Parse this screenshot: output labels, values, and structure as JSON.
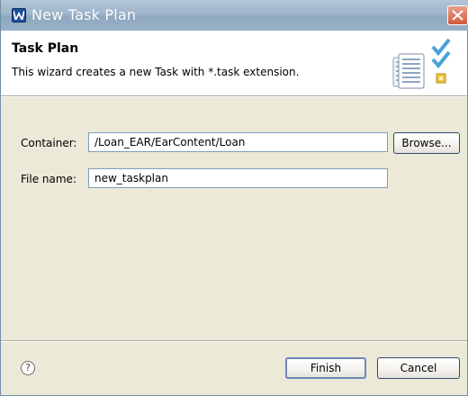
{
  "window": {
    "title": "New Task Plan",
    "app_icon": "websphere-icon",
    "close_icon": "close-icon"
  },
  "header": {
    "title": "Task Plan",
    "description": "This wizard creates a new Task with *.task extension.",
    "icon": "task-checklist-icon"
  },
  "form": {
    "container_label": "Container:",
    "container_value": "/Loan_EAR/EarContent/Loan",
    "browse_label": "Browse...",
    "filename_label": "File name:",
    "filename_value": "new_taskplan"
  },
  "footer": {
    "help_symbol": "?",
    "finish_label": "Finish",
    "cancel_label": "Cancel"
  },
  "colors": {
    "titlebar": "#9fb5cb",
    "dialog_bg": "#ece9d8",
    "close_button": "#cf5a3a"
  }
}
